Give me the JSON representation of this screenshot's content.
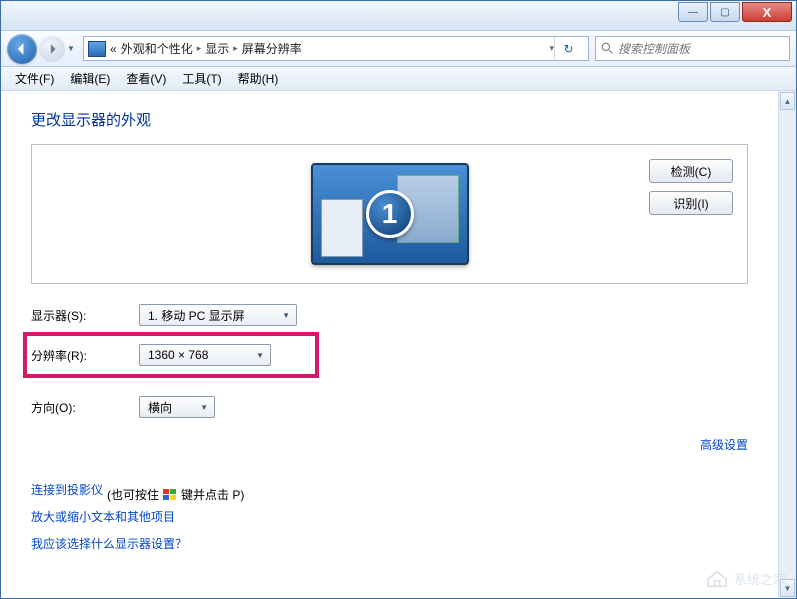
{
  "titlebar": {
    "minimize": "—",
    "maximize": "▢",
    "close": "X"
  },
  "nav": {
    "breadcrumb_prefix": "«",
    "crumb1": "外观和个性化",
    "crumb2": "显示",
    "crumb3": "屏幕分辨率",
    "search_placeholder": "搜索控制面板"
  },
  "menu": {
    "file": "文件(F)",
    "edit": "编辑(E)",
    "view": "查看(V)",
    "tools": "工具(T)",
    "help": "帮助(H)"
  },
  "main": {
    "heading": "更改显示器的外观",
    "detect_btn": "检测(C)",
    "identify_btn": "识别(I)",
    "monitor_number": "1",
    "display_label": "显示器(S):",
    "display_value": "1. 移动 PC 显示屏",
    "resolution_label": "分辨率(R):",
    "resolution_value": "1360 × 768",
    "orientation_label": "方向(O):",
    "orientation_value": "横向",
    "advanced_link": "高级设置",
    "projector_link_1": "连接到投影仪",
    "projector_link_2": "(也可按住",
    "projector_link_3": "键并点击 P)",
    "zoom_link": "放大或缩小文本和其他项目",
    "help_link": "我应该选择什么显示器设置？"
  },
  "watermark": "系统之家"
}
